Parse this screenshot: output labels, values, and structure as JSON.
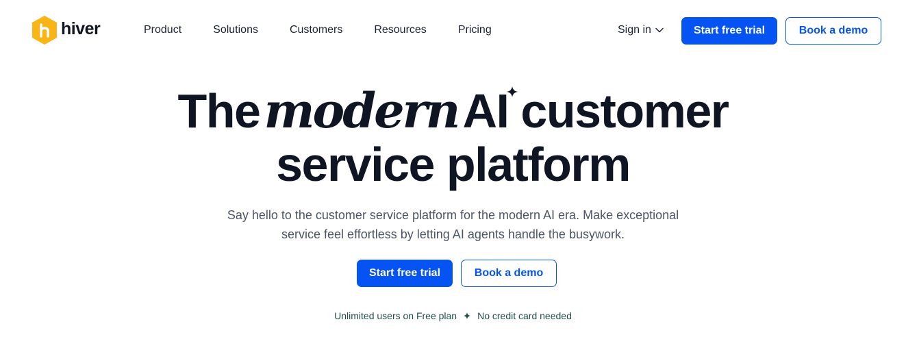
{
  "brand": {
    "name": "hiver",
    "logo_color": "#f9b515",
    "accent_color": "#0553f2"
  },
  "nav": {
    "links": [
      "Product",
      "Solutions",
      "Customers",
      "Resources",
      "Pricing"
    ],
    "sign_in": "Sign in",
    "trial_label": "Start free trial",
    "demo_label": "Book a demo"
  },
  "hero": {
    "title_the": "The",
    "title_modern": "modern",
    "title_ai": "AI",
    "title_customer": "customer",
    "title_line2": "service platform",
    "subtitle_line1": "Say hello to the customer service platform for the modern AI era. Make exceptional",
    "subtitle_line2": "service feel effortless by letting AI agents handle the busywork.",
    "trial_label": "Start free trial",
    "demo_label": "Book a demo",
    "footnote_left": "Unlimited users on Free plan",
    "footnote_right": "No credit card needed"
  }
}
